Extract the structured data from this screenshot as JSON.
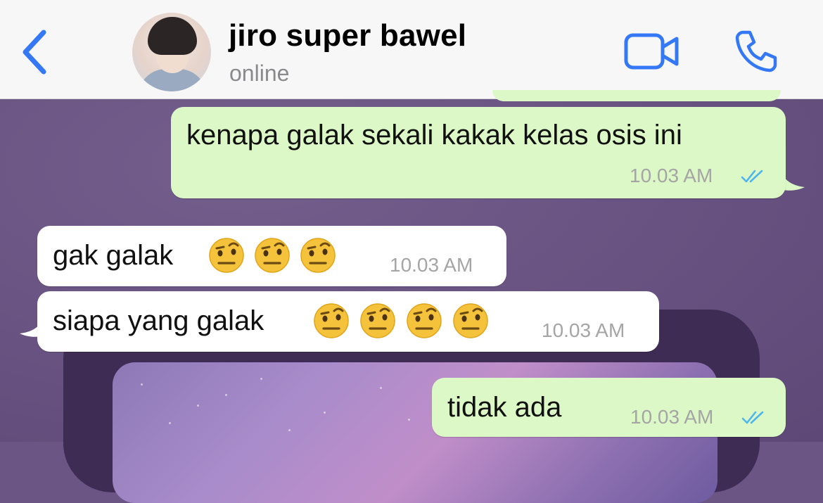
{
  "header": {
    "contact_name": "jiro super bawel",
    "status": "online",
    "icons": {
      "back": "chevron-left-icon",
      "avatar": "avatar",
      "video": "video-camera-icon",
      "phone": "phone-icon"
    },
    "accent_color": "#3478f6"
  },
  "chat": {
    "colors": {
      "outgoing_bubble": "#dcf8c6",
      "incoming_bubble": "#ffffff",
      "read_ticks": "#4fb6ec",
      "wallpaper": "#6b5585"
    },
    "messages": [
      {
        "direction": "outgoing",
        "text": "kenapa galak sekali kakak kelas osis ini",
        "time": "10.03 AM",
        "status": "read"
      },
      {
        "direction": "incoming",
        "text": "gak galak",
        "emoji": [
          "raised-eyebrow-emoji",
          "raised-eyebrow-emoji",
          "raised-eyebrow-emoji"
        ],
        "time": "10.03 AM"
      },
      {
        "direction": "incoming",
        "text": "siapa yang galak",
        "emoji": [
          "raised-eyebrow-emoji",
          "raised-eyebrow-emoji",
          "raised-eyebrow-emoji",
          "raised-eyebrow-emoji"
        ],
        "time": "10.03 AM"
      },
      {
        "direction": "outgoing",
        "text": "tidak ada",
        "time": "10.03 AM",
        "status": "read"
      }
    ]
  }
}
